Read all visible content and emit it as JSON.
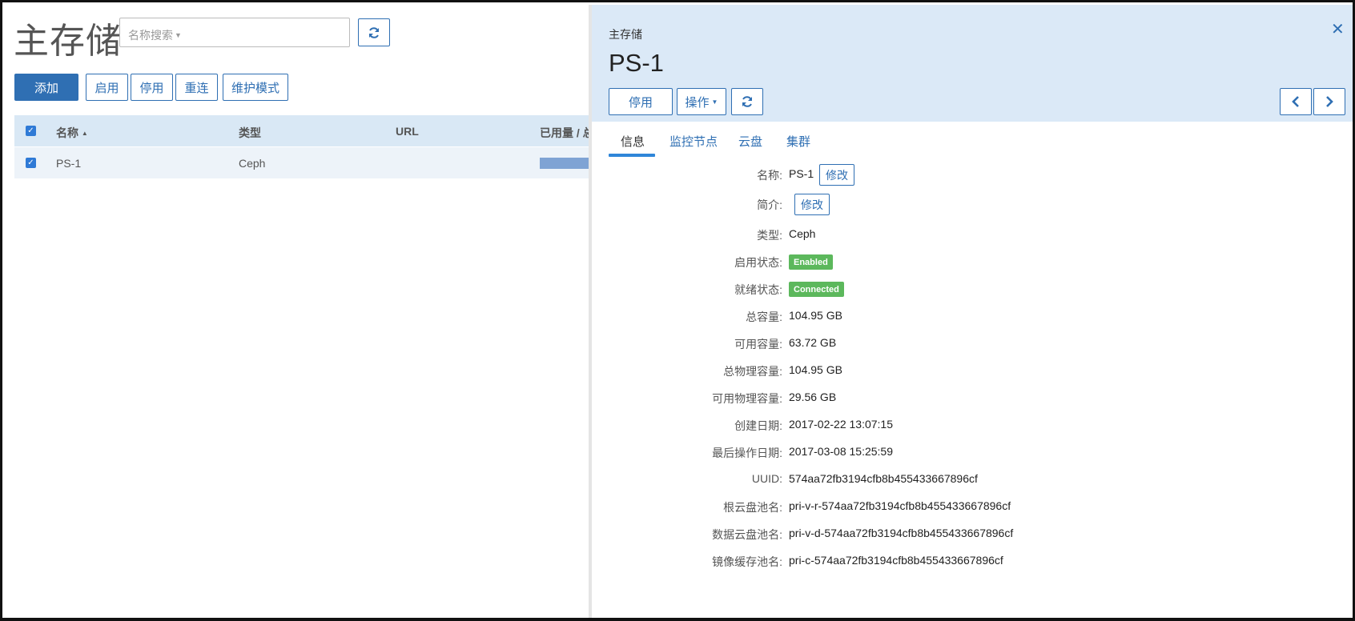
{
  "list": {
    "title": "主存储",
    "search": {
      "placeholder": "名称搜索"
    },
    "toolbar": {
      "add": "添加",
      "enable": "启用",
      "disable": "停用",
      "reconnect": "重连",
      "maintenance": "维护模式"
    },
    "columns": {
      "name": "名称",
      "name_sort": "▲",
      "type": "类型",
      "url": "URL",
      "usage": "已用量 / 总"
    },
    "rows": [
      {
        "name": "PS-1",
        "type": "Ceph",
        "url": ""
      }
    ]
  },
  "drawer": {
    "breadcrumb": "主存储",
    "title": "PS-1",
    "actions": {
      "disable": "停用",
      "operations": "操作"
    },
    "tabs": [
      "信息",
      "监控节点",
      "云盘",
      "集群"
    ],
    "edit_label": "修改",
    "fields": {
      "name": {
        "label": "名称:",
        "value": "PS-1"
      },
      "description": {
        "label": "简介:",
        "value": ""
      },
      "type": {
        "label": "类型:",
        "value": "Ceph"
      },
      "state": {
        "label": "启用状态:",
        "value": "Enabled",
        "color": "#5cb85c"
      },
      "status": {
        "label": "就绪状态:",
        "value": "Connected",
        "color": "#5cb85c"
      },
      "total_capacity": {
        "label": "总容量:",
        "value": "104.95 GB"
      },
      "available_capacity": {
        "label": "可用容量:",
        "value": "63.72 GB"
      },
      "total_physical_capacity": {
        "label": "总物理容量:",
        "value": "104.95 GB"
      },
      "available_physical_capacity": {
        "label": "可用物理容量:",
        "value": "29.56 GB"
      },
      "create_date": {
        "label": "创建日期:",
        "value": "2017-02-22 13:07:15"
      },
      "last_op_date": {
        "label": "最后操作日期:",
        "value": "2017-03-08 15:25:59"
      },
      "uuid": {
        "label": "UUID:",
        "value": "574aa72fb3194cfb8b455433667896cf"
      },
      "root_volume_pool": {
        "label": "根云盘池名:",
        "value": "pri-v-r-574aa72fb3194cfb8b455433667896cf"
      },
      "data_volume_pool": {
        "label": "数据云盘池名:",
        "value": "pri-v-d-574aa72fb3194cfb8b455433667896cf"
      },
      "image_cache_pool": {
        "label": "镜像缓存池名:",
        "value": "pri-c-574aa72fb3194cfb8b455433667896cf"
      }
    }
  },
  "colors": {
    "accent": "#2f6fb3",
    "header_bg": "#dbe9f7",
    "table_head_bg": "#d9e8f5",
    "success": "#5cb85c"
  }
}
